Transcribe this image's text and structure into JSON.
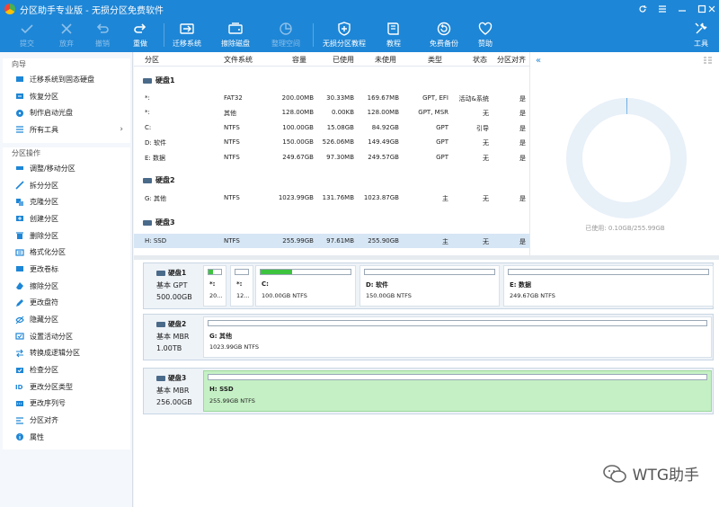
{
  "window": {
    "title": "分区助手专业版 - 无损分区免费软件"
  },
  "toolbar": {
    "commit": "提交",
    "discard": "放弃",
    "undo": "撤销",
    "redo": "重做",
    "migrate_os": "迁移系统",
    "wipe_disk": "擦除磁盘",
    "free_space": "整理空间",
    "partition_recovery": "无损分区教程",
    "tutorial": "教程",
    "free_backup": "免费备份",
    "donate": "赞助",
    "tools": "工具"
  },
  "sidebar": {
    "wizard_title": "向导",
    "wizard_items": [
      {
        "label": "迁移系统到固态硬盘",
        "icon": "migrate-ssd-icon"
      },
      {
        "label": "恢复分区",
        "icon": "restore-partition-icon"
      },
      {
        "label": "制作启动光盘",
        "icon": "bootable-disc-icon"
      },
      {
        "label": "所有工具",
        "icon": "all-tools-icon"
      }
    ],
    "ops_title": "分区操作",
    "ops_items": [
      {
        "label": "调整/移动分区"
      },
      {
        "label": "拆分分区"
      },
      {
        "label": "克隆分区"
      },
      {
        "label": "创建分区"
      },
      {
        "label": "删除分区"
      },
      {
        "label": "格式化分区"
      },
      {
        "label": "更改卷标"
      },
      {
        "label": "擦除分区"
      },
      {
        "label": "更改盘符"
      },
      {
        "label": "隐藏分区"
      },
      {
        "label": "设置活动分区"
      },
      {
        "label": "转换成逻辑分区"
      },
      {
        "label": "检查分区"
      },
      {
        "label": "更改分区类型"
      },
      {
        "label": "更改序列号"
      },
      {
        "label": "分区对齐"
      },
      {
        "label": "属性"
      }
    ]
  },
  "table": {
    "headers": [
      "分区",
      "文件系统",
      "容量",
      "已使用",
      "未使用",
      "类型",
      "状态",
      "分区对齐"
    ],
    "disks": [
      {
        "name": "硬盘1",
        "rows": [
          [
            "*:",
            "FAT32",
            "200.00MB",
            "30.33MB",
            "169.67MB",
            "GPT, EFI",
            "活动&系统",
            "是"
          ],
          [
            "*:",
            "其他",
            "128.00MB",
            "0.00KB",
            "128.00MB",
            "GPT, MSR",
            "无",
            "是"
          ],
          [
            "C:",
            "NTFS",
            "100.00GB",
            "15.08GB",
            "84.92GB",
            "GPT",
            "引导",
            "是"
          ],
          [
            "D: 软件",
            "NTFS",
            "150.00GB",
            "526.06MB",
            "149.49GB",
            "GPT",
            "无",
            "是"
          ],
          [
            "E: 数据",
            "NTFS",
            "249.67GB",
            "97.30MB",
            "249.57GB",
            "GPT",
            "无",
            "是"
          ]
        ]
      },
      {
        "name": "硬盘2",
        "rows": [
          [
            "G: 其他",
            "NTFS",
            "1023.99GB",
            "131.76MB",
            "1023.87GB",
            "主",
            "无",
            "是"
          ]
        ]
      },
      {
        "name": "硬盘3",
        "rows": [
          [
            "H: SSD",
            "NTFS",
            "255.99GB",
            "97.61MB",
            "255.90GB",
            "主",
            "无",
            "是"
          ]
        ]
      }
    ]
  },
  "right_panel": {
    "usage": "已使用: 0.10GB/255.99GB",
    "used_fraction": 0.0004
  },
  "diskmap": {
    "disks": [
      {
        "name": "硬盘1",
        "type": "基本 GPT",
        "size": "500.00GB",
        "partitions": [
          {
            "label": "*:",
            "desc": "20...",
            "fill": 0.15
          },
          {
            "label": "*:",
            "desc": "12...",
            "fill": 0.0
          },
          {
            "label": "C:",
            "desc": "100.00GB NTFS",
            "fill": 0.15
          },
          {
            "label": "D: 软件",
            "desc": "150.00GB NTFS",
            "fill": 0.0
          },
          {
            "label": "E: 数据",
            "desc": "249.67GB NTFS",
            "fill": 0.0
          }
        ]
      },
      {
        "name": "硬盘2",
        "type": "基本 MBR",
        "size": "1.00TB",
        "partitions": [
          {
            "label": "G: 其他",
            "desc": "1023.99GB NTFS",
            "fill": 0.0
          }
        ]
      },
      {
        "name": "硬盘3",
        "type": "基本 MBR",
        "size": "256.00GB",
        "partitions": [
          {
            "label": "H: SSD",
            "desc": "255.99GB NTFS",
            "fill": 0.0
          }
        ]
      }
    ]
  },
  "watermark": {
    "text": "WTG助手"
  },
  "colors": {
    "accent": "#1e86d6",
    "selected_row": "#d6e6f5",
    "selected_partition": "#c5f0c5",
    "usage_fill": "#3ec33e",
    "pie_ring": "#e8f0f8"
  }
}
